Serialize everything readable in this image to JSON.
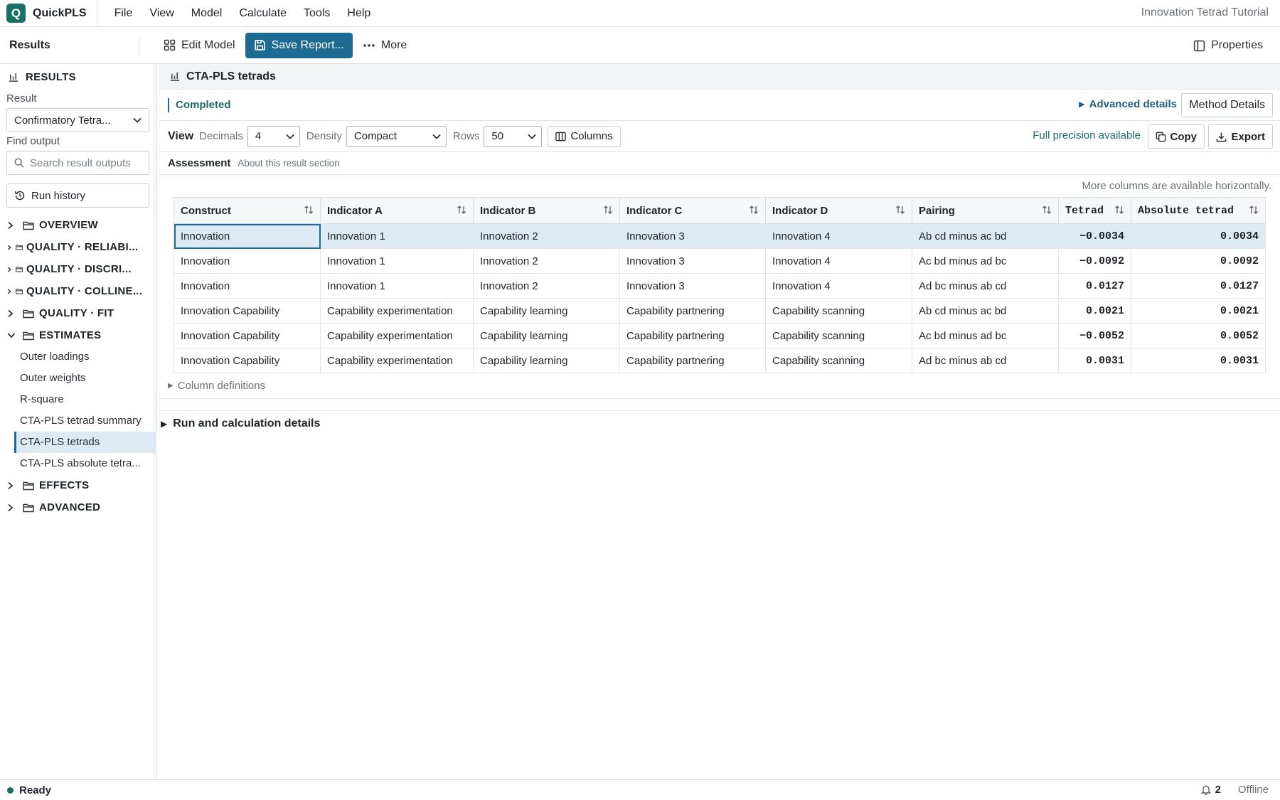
{
  "app": {
    "name": "QuickPLS",
    "logo_letter": "Q",
    "document_title": "Innovation Tetrad Tutorial"
  },
  "menu": [
    "File",
    "View",
    "Model",
    "Calculate",
    "Tools",
    "Help"
  ],
  "toolbar": {
    "title": "Results",
    "edit_model": "Edit Model",
    "save_report": "Save Report...",
    "more": "More",
    "properties": "Properties"
  },
  "sidebar": {
    "heading": "RESULTS",
    "result_label": "Result",
    "result_value": "Confirmatory Tetra...",
    "find_label": "Find output",
    "search_placeholder": "Search result outputs",
    "run_history": "Run history",
    "groups": {
      "overview": "OVERVIEW",
      "reliability": "QUALITY · RELIABI...",
      "discrim": "QUALITY · DISCRI...",
      "collin": "QUALITY · COLLINE...",
      "fit": "QUALITY · FIT",
      "estimates": "ESTIMATES",
      "effects": "EFFECTS",
      "advanced": "ADVANCED"
    },
    "estimates_items": [
      "Outer loadings",
      "Outer weights",
      "R-square",
      "CTA-PLS tetrad summary",
      "CTA-PLS tetrads",
      "CTA-PLS absolute tetra..."
    ]
  },
  "main": {
    "title": "CTA-PLS tetrads",
    "status": "Completed",
    "advanced_details": "Advanced details",
    "method_details": "Method Details",
    "view": {
      "label": "View",
      "decimals_label": "Decimals",
      "decimals_value": "4",
      "density_label": "Density",
      "density_value": "Compact",
      "rows_label": "Rows",
      "rows_value": "50",
      "columns": "Columns",
      "full_precision": "Full precision available",
      "copy": "Copy",
      "export": "Export"
    },
    "assessment": {
      "title": "Assessment",
      "subtitle": "About this result section"
    },
    "more_columns_note": "More columns are available horizontally.",
    "table": {
      "headers": [
        "Construct",
        "Indicator A",
        "Indicator B",
        "Indicator C",
        "Indicator D",
        "Pairing",
        "Tetrad",
        "Absolute tetrad"
      ],
      "rows": [
        [
          "Innovation",
          "Innovation 1",
          "Innovation 2",
          "Innovation 3",
          "Innovation 4",
          "Ab cd minus ac bd",
          "−0.0034",
          "0.0034"
        ],
        [
          "Innovation",
          "Innovation 1",
          "Innovation 2",
          "Innovation 3",
          "Innovation 4",
          "Ac bd minus ad bc",
          "−0.0092",
          "0.0092"
        ],
        [
          "Innovation",
          "Innovation 1",
          "Innovation 2",
          "Innovation 3",
          "Innovation 4",
          "Ad bc minus ab cd",
          "0.0127",
          "0.0127"
        ],
        [
          "Innovation Capability",
          "Capability experimentation",
          "Capability learning",
          "Capability partnering",
          "Capability scanning",
          "Ab cd minus ac bd",
          "0.0021",
          "0.0021"
        ],
        [
          "Innovation Capability",
          "Capability experimentation",
          "Capability learning",
          "Capability partnering",
          "Capability scanning",
          "Ac bd minus ad bc",
          "−0.0052",
          "0.0052"
        ],
        [
          "Innovation Capability",
          "Capability experimentation",
          "Capability learning",
          "Capability partnering",
          "Capability scanning",
          "Ad bc minus ab cd",
          "0.0031",
          "0.0031"
        ]
      ]
    },
    "column_definitions": "Column definitions",
    "run_details": "Run and calculation details"
  },
  "statusbar": {
    "status": "Ready",
    "notifications": "2",
    "connection": "Offline"
  }
}
